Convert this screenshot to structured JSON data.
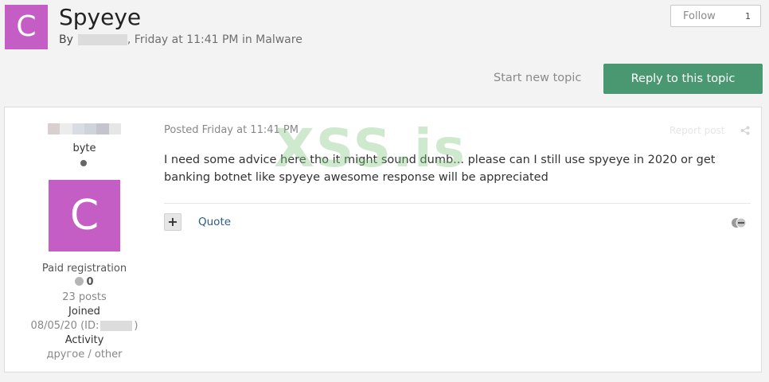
{
  "topic": {
    "avatar_letter": "C",
    "title": "Spyeye",
    "by_label": "By",
    "meta_suffix": ", Friday at 11:41 PM in Malware"
  },
  "follow": {
    "label": "Follow",
    "count": "1"
  },
  "actions": {
    "start_topic": "Start new topic",
    "reply": "Reply to this topic"
  },
  "author": {
    "title": "byte",
    "avatar_letter": "C",
    "group": "Paid registration",
    "reputation": "0",
    "posts": "23 posts",
    "joined_label": "Joined",
    "joined_date": "08/05/20 (ID:",
    "joined_close": ")",
    "activity_label": "Activity",
    "activity_value": "другое / other"
  },
  "post": {
    "date": "Posted Friday at 11:41 PM",
    "report": "Report post",
    "watermark": "XSS.is",
    "body": "I need some advice here tho it might sound dumb... please can I still use spyeye in 2020 or get banking botnet like spyeye awesome response will be appreciated",
    "multiquote": "+",
    "quote": "Quote"
  },
  "colors": {
    "avatar": "#c45ec4",
    "reply_button": "#4a9872",
    "link": "#2c5b8a",
    "watermark": "#80c480"
  },
  "icons": {
    "share": "share-icon",
    "reaction": "reaction-icon",
    "online": "online-indicator-icon",
    "reputation": "reputation-dot-icon"
  }
}
